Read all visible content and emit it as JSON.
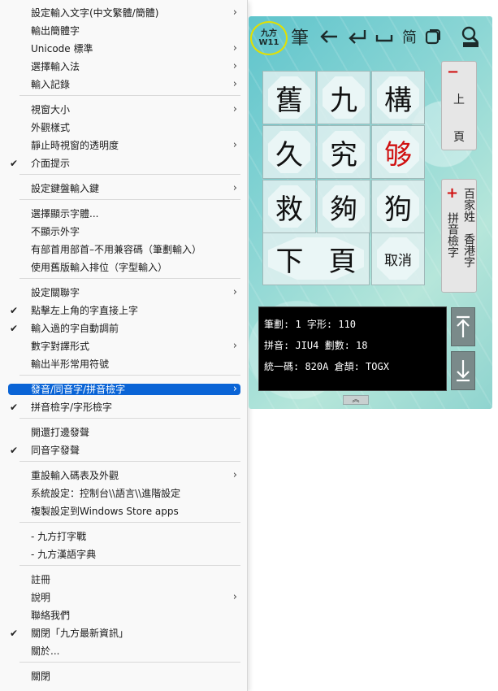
{
  "menu": {
    "items": [
      {
        "label": "設定輸入文字(中文繁體/簡體)",
        "submenu": true,
        "checked": false
      },
      {
        "label": "輸出簡體字",
        "submenu": false,
        "checked": false
      },
      {
        "label": "Unicode 標準",
        "submenu": true,
        "checked": false
      },
      {
        "label": "選擇輸入法",
        "submenu": true,
        "checked": false
      },
      {
        "label": "輸入記錄",
        "submenu": true,
        "checked": false
      },
      {
        "label": "視窗大小",
        "submenu": true,
        "checked": false
      },
      {
        "label": "外觀樣式",
        "submenu": false,
        "checked": false
      },
      {
        "label": "靜止時視窗的透明度",
        "submenu": true,
        "checked": false
      },
      {
        "label": "介面提示",
        "submenu": false,
        "checked": true
      },
      {
        "label": "設定鍵盤輸入鍵",
        "submenu": true,
        "checked": false
      },
      {
        "label": "選擇顯示字體...",
        "submenu": false,
        "checked": false
      },
      {
        "label": "不顯示外字",
        "submenu": false,
        "checked": false
      },
      {
        "label": "有部首用部首–不用兼容碼（筆劃輸入）",
        "submenu": false,
        "checked": false
      },
      {
        "label": "使用舊版輸入排位（字型輸入）",
        "submenu": false,
        "checked": false
      },
      {
        "label": "設定關聯字",
        "submenu": true,
        "checked": false
      },
      {
        "label": "點擊左上角的字直接上字",
        "submenu": false,
        "checked": true
      },
      {
        "label": "輸入過的字自動調前",
        "submenu": false,
        "checked": true
      },
      {
        "label": "數字對譯形式",
        "submenu": true,
        "checked": false
      },
      {
        "label": "輸出半形常用符號",
        "submenu": false,
        "checked": false
      },
      {
        "label": "發音/同音字/拼音檢字",
        "submenu": true,
        "checked": false,
        "active": true
      },
      {
        "label": "拼音檢字/字形檢字",
        "submenu": false,
        "checked": true
      },
      {
        "label": "開還打邊發聲",
        "submenu": false,
        "checked": false
      },
      {
        "label": "同音字發聲",
        "submenu": false,
        "checked": true
      },
      {
        "label": "重設輸入碼表及外觀",
        "submenu": true,
        "checked": false
      },
      {
        "label": "系統設定：控制台\\\\語言\\\\進階設定",
        "submenu": false,
        "checked": false
      },
      {
        "label": "複製設定到Windows Store apps",
        "submenu": false,
        "checked": false
      },
      {
        "label": "- 九方打字戰",
        "submenu": false,
        "checked": false
      },
      {
        "label": "- 九方漢語字典",
        "submenu": false,
        "checked": false
      },
      {
        "label": "註冊",
        "submenu": false,
        "checked": false
      },
      {
        "label": "說明",
        "submenu": true,
        "checked": false
      },
      {
        "label": "聯絡我們",
        "submenu": false,
        "checked": false
      },
      {
        "label": "關閉「九方最新資訊」",
        "submenu": false,
        "checked": true
      },
      {
        "label": "關於...",
        "submenu": false,
        "checked": false
      },
      {
        "label": "關閉",
        "submenu": false,
        "checked": false
      }
    ],
    "check_glyph": "✔",
    "arrow_glyph": "›"
  },
  "ime": {
    "logo_line1": "九方",
    "logo_line2": "W11",
    "toolbar": {
      "stroke": "筆",
      "simplified": "简",
      "dictionary_icon": "magnifier-dictionary-icon"
    },
    "candidates": [
      "舊",
      "九",
      "構",
      "久",
      "究",
      "够",
      "救",
      "夠",
      "狗"
    ],
    "bottom_row": {
      "left": "下",
      "right": "頁",
      "cancel": "取消"
    },
    "page_up": {
      "symbol": "−",
      "char1": "上",
      "char2": "頁"
    },
    "lookup": {
      "symbol": "+",
      "col1": "百家姓",
      "col2": "香港字",
      "col3": "拼音檢字"
    },
    "info": {
      "line1": "筆劃: 1 字形: 110",
      "line2": "拼音: JIU4 劃數: 18",
      "line3": "統一碼: 820A 倉頡: TOGX"
    },
    "colors": {
      "highlight": "#d01010",
      "accent": "#0a64d6"
    }
  }
}
